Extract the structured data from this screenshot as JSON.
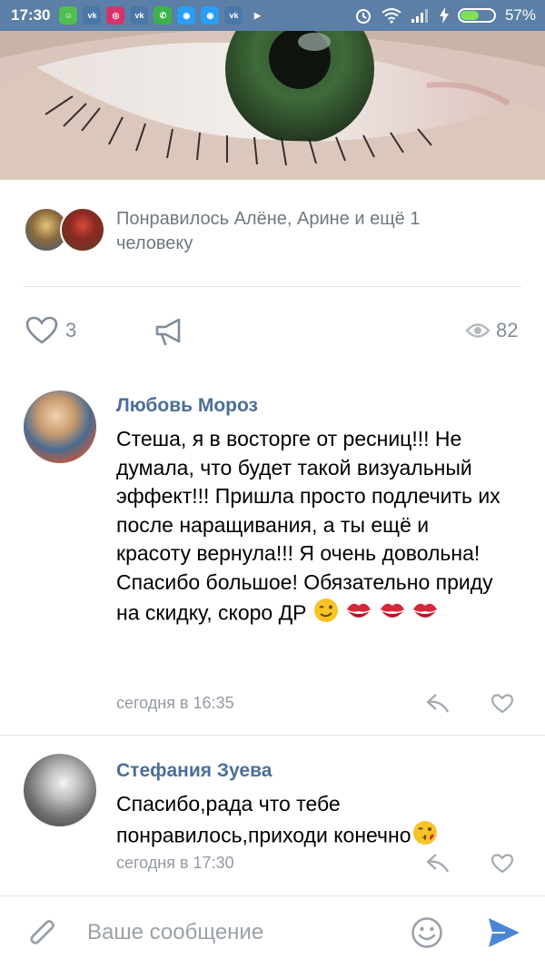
{
  "status_bar": {
    "time": "17:30",
    "apps": [
      {
        "icon": "messenger-icon",
        "color": "#4fbf4f",
        "label": "☺"
      },
      {
        "icon": "vk-icon",
        "color": "#4a76a8",
        "label": "vk"
      },
      {
        "icon": "instagram-icon",
        "color": "#d6336c",
        "label": "◎"
      },
      {
        "icon": "vk-icon",
        "color": "#4a76a8",
        "label": "vk"
      },
      {
        "icon": "phone-icon",
        "color": "#3cb34a",
        "label": "✆"
      },
      {
        "icon": "chat-icon",
        "color": "#2a9df4",
        "label": "◉"
      },
      {
        "icon": "chat-icon",
        "color": "#2a9df4",
        "label": "◉"
      },
      {
        "icon": "vk-icon",
        "color": "#4a76a8",
        "label": "vk"
      },
      {
        "icon": "play-store-icon",
        "color": "#5b7fa6",
        "label": "▶"
      }
    ],
    "battery_percent": "57%",
    "battery_level": 0.57
  },
  "post": {
    "likes_text": "Понравилось Алёне, Арине и ещё 1 человеку",
    "like_count": "3",
    "view_count": "82"
  },
  "comments": [
    {
      "author": "Любовь Мороз",
      "text": "Стеша, я в восторге от ресниц!!! Не думала, что будет такой визуальный эффект!!! Пришла просто подлечить их после наращивания, а ты ещё и красоту вернула!!! Я очень довольна! Спасибо большое! Обязательно приду на скидку, скоро ДР",
      "time": "сегодня в 16:35"
    },
    {
      "author": "Стефания Зуева",
      "text": "Спасибо,рада что тебе понравилось,приходи конечно",
      "time": "сегодня в 17:30"
    }
  ],
  "composer": {
    "placeholder": "Ваше сообщение"
  },
  "colors": {
    "accent": "#4a6f99",
    "secondary": "#818c99",
    "send": "#4a86d6"
  }
}
